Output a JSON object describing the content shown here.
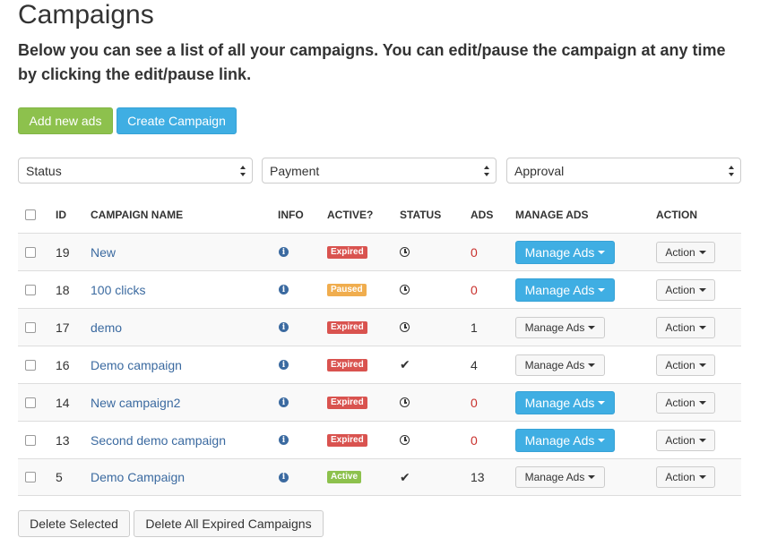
{
  "page": {
    "title": "Campaigns",
    "intro": "Below you can see a list of all your campaigns. You can edit/pause the campaign at any time by clicking the edit/pause link."
  },
  "toolbar": {
    "add_ads_label": "Add new ads",
    "create_campaign_label": "Create Campaign"
  },
  "filters": {
    "status": "Status",
    "payment": "Payment",
    "approval": "Approval"
  },
  "table": {
    "headers": [
      "ID",
      "CAMPAIGN NAME",
      "INFO",
      "ACTIVE?",
      "STATUS",
      "ADS",
      "MANAGE ADS",
      "ACTION"
    ],
    "rows": [
      {
        "id": "19",
        "name": "New",
        "active": "Expired",
        "status_icon": "clock-icon",
        "ads": "0",
        "manage_label": "Manage Ads",
        "manage_style": "primary",
        "action_label": "Action"
      },
      {
        "id": "18",
        "name": "100 clicks",
        "active": "Paused",
        "status_icon": "clock-icon",
        "ads": "0",
        "manage_label": "Manage Ads",
        "manage_style": "primary",
        "action_label": "Action"
      },
      {
        "id": "17",
        "name": "demo",
        "active": "Expired",
        "status_icon": "clock-icon",
        "ads": "1",
        "manage_label": "Manage Ads",
        "manage_style": "default",
        "action_label": "Action"
      },
      {
        "id": "16",
        "name": "Demo campaign",
        "active": "Expired",
        "status_icon": "check-icon",
        "ads": "4",
        "manage_label": "Manage Ads",
        "manage_style": "default",
        "action_label": "Action"
      },
      {
        "id": "14",
        "name": "New campaign2",
        "active": "Expired",
        "status_icon": "clock-icon",
        "ads": "0",
        "manage_label": "Manage Ads",
        "manage_style": "primary",
        "action_label": "Action"
      },
      {
        "id": "13",
        "name": "Second demo campaign",
        "active": "Expired",
        "status_icon": "clock-icon",
        "ads": "0",
        "manage_label": "Manage Ads",
        "manage_style": "primary",
        "action_label": "Action"
      },
      {
        "id": "5",
        "name": "Demo Campaign",
        "active": "Active",
        "status_icon": "check-icon",
        "ads": "13",
        "manage_label": "Manage Ads",
        "manage_style": "default",
        "action_label": "Action"
      }
    ]
  },
  "bottom": {
    "delete_selected_label": "Delete Selected",
    "delete_expired_label": "Delete All Expired Campaigns"
  },
  "colors": {
    "green": "#8dc14d",
    "blue": "#3faee3",
    "expired": "#d9534f",
    "paused": "#f0ad4e",
    "link": "#3b6aa0",
    "zero_ads": "#c9302c"
  }
}
